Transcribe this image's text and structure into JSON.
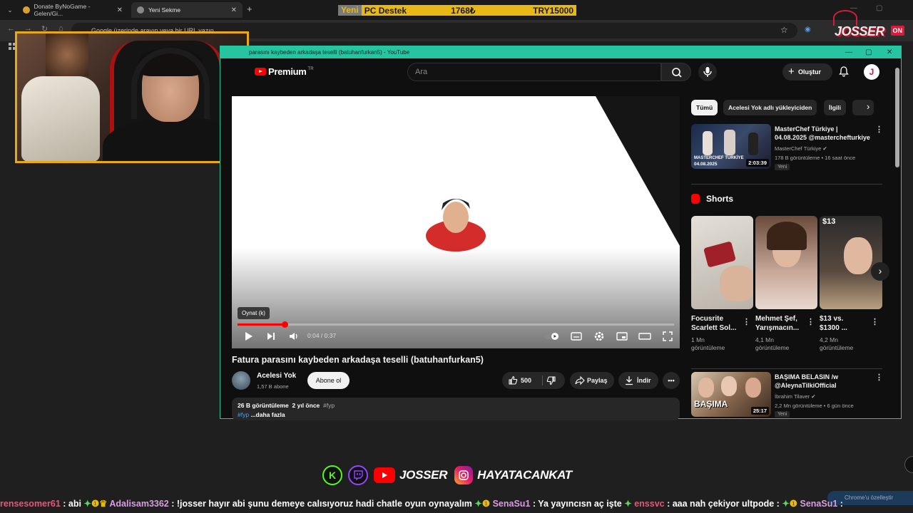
{
  "browser": {
    "tabs": [
      {
        "title": "Donate ByNoGame - Gelen/Gi..."
      },
      {
        "title": "Yeni Sekme"
      }
    ],
    "omnibox_placeholder": "Google üzerinde arayın veya bir URL yazın"
  },
  "banner": {
    "label1": "Yeni",
    "label2": "PC Destek",
    "amount": "1768₺",
    "goal": "TRY15000"
  },
  "logo": {
    "text": "JOSSER",
    "badge": "ON"
  },
  "yt": {
    "window_title": "parasını kaybeden arkadaşa teselli (batuhanfurkan5) - YouTube",
    "brand": "Premium",
    "region": "TR",
    "search_placeholder": "Ara",
    "create_label": "Oluştur",
    "avatar_letter": "J",
    "player": {
      "tooltip": "Oynat (k)",
      "time": "0:04 / 0:37",
      "progress_fraction": 0.108
    },
    "video": {
      "title": "Fatura parasını kaybeden arkadaşa teselli (batuhanfurkan5)",
      "channel": "Acelesi Yok",
      "subscribers": "1,57 B abone",
      "subscribe_label": "Abone ol",
      "likes": "500",
      "share_label": "Paylaş",
      "download_label": "İndir",
      "views": "26 B görüntüleme",
      "ago": "2 yıl önce",
      "hashtag": "#fyp",
      "hashtag2": "#fyp",
      "more": "...daha fazla"
    },
    "chips": [
      "Tümü",
      "Acelesi Yok adlı yükleyiciden",
      "İlgili"
    ],
    "recs": [
      {
        "title1": "MasterChef Türkiye |",
        "title2": "04.08.2025 @masterchefturkiye",
        "channel": "MasterChef Türkiye",
        "meta": "178 B görüntüleme • 16 saat önce",
        "badge": "Yeni",
        "duration": "2:03:39",
        "thumb_text1": "MASTERCHEF TÜRKİYE",
        "thumb_text2": "04.08.2025"
      },
      {
        "title1": "BAŞIMA BELASIN /w",
        "title2": "@AleynaTilkiOfficial",
        "channel": "İbrahim Tilaver",
        "meta": "2,2 Mn görüntüleme • 6 gün önce",
        "badge": "Yeni",
        "duration": "25:17",
        "thumb_text1": "BAŞIMA"
      }
    ],
    "shorts_heading": "Shorts",
    "shorts": [
      {
        "title1": "Focusrite",
        "title2": "Scarlett Sol...",
        "views": "1 Mn",
        "views2": "görüntüleme"
      },
      {
        "title1": "Mehmet Şef,",
        "title2": "Yarışmacın...",
        "views": "4,1 Mn",
        "views2": "görüntüleme"
      },
      {
        "title1": "$13 vs.",
        "title2": "$1300 ...",
        "views": "4,2 Mn",
        "views2": "görüntüleme",
        "thumb_text": "$13"
      }
    ]
  },
  "overlay": {
    "youtube_name": "JOSSER",
    "instagram_name": "HAYATACANKAT",
    "kick_letter": "K",
    "chrome_custom": "Chrome'u özelleştir",
    "ticker": [
      {
        "user": "rensesomer61",
        "msg": ": abi"
      },
      {
        "user": "Adalisam3362",
        "msg": ": !josser hayır abi şunu demeye calısıyoruz hadi chatle oyun oynayalım"
      },
      {
        "user": "SenaSu1",
        "msg": ": Ya yayıncısn aç işte"
      },
      {
        "user": "enssvc",
        "msg": ": aaa nah çekiyor"
      },
      {
        "user": "ultpode",
        "msg": ":"
      },
      {
        "user": "SenaSu1",
        "msg": ":"
      }
    ]
  },
  "colors": {
    "accent_red": "#ff0000",
    "window_border": "#1ec9a0",
    "banner_yellow": "#e8b915",
    "webcam_border": "#e8a915"
  }
}
